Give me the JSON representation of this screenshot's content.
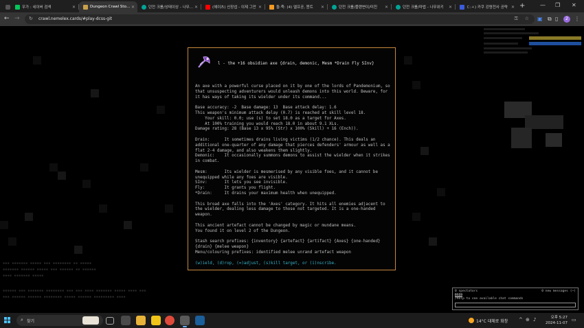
{
  "browser": {
    "tabs": [
      {
        "title": "우가 : 네이버 검색",
        "favicon_color": "#03c75a"
      },
      {
        "title": "Dungeon Crawl Stone Soup",
        "favicon_color": "#c9a04a",
        "active": true
      },
      {
        "title": "던전 크롤/상태이상 - 나무위키",
        "favicon_color": "#00a495"
      },
      {
        "title": "(헤이츠) 신장섭 - 이제 그만",
        "favicon_color": "#ff0000"
      },
      {
        "title": "돌·죽: (4) 엘프공, 몽트",
        "favicon_color": "#f59a23"
      },
      {
        "title": "던전 크롤/플랜변이/미친",
        "favicon_color": "#00a495"
      },
      {
        "title": "던전 크롤/마법 - 나무위키",
        "favicon_color": "#00a495"
      },
      {
        "title": "ㄷ:ㅅ) 카쿠 강령전사 공략",
        "favicon_color": "#3b5bdb"
      }
    ],
    "new_tab_label": "+",
    "url": "crawl.nemelex.cards/#play-dcss-git",
    "profile_initial": "2"
  },
  "popup": {
    "title": "l - the +16 obsidian axe {drain, demonic, Mesm *Drain Fly SInv}",
    "lines": [
      {
        "text": "An axe with a powerful curse placed on it by one of the lords of Pandemonium, so"
      },
      {
        "text": "that unsuspecting adventurers would unleash demons into this world. Beware, for"
      },
      {
        "text": "it has ways of taking its wielder under its command..."
      },
      {
        "text": "Base accuracy: -2  Base damage: 13  Base attack delay: 1.6",
        "gap": true
      },
      {
        "text": "This weapon's minimum attack delay (0.7) is reached at skill level 18."
      },
      {
        "text": "    Your skill: 0.0; use (s) to set 18.0 as a target for Axes."
      },
      {
        "text": "    At 100% training you would reach 18.0 in about 9.1 XLs."
      },
      {
        "text": "Damage rating: 28 (Base 13 x 95% (Str) x 100% (Skill) + 16 (Ench))."
      },
      {
        "text": "Drain:      It sometimes drains living victims (1/2 chance). This deals an",
        "gap": true
      },
      {
        "text": "additional one-quarter of any damage that pierces defenders' armour as well as a"
      },
      {
        "text": "flat 2-4 damage, and also weakens them slightly."
      },
      {
        "text": "Demonic:    It occasionally summons demons to assist the wielder when it strikes"
      },
      {
        "text": "in combat."
      },
      {
        "text": "Mesm:       Its wielder is mesmerised by any visible foes, and it cannot be",
        "gap": true
      },
      {
        "text": "unequipped while any foes are visible."
      },
      {
        "text": "SInv:       It lets you see invisible."
      },
      {
        "text": "Fly:        It grants you flight."
      },
      {
        "text": "*Drain:     It drains your maximum health when unequipped."
      },
      {
        "text": "This broad axe falls into the 'Axes' category. It hits all enemies adjacent to",
        "gap": true
      },
      {
        "text": "the wielder, dealing less damage to those not targeted. It is a one-handed"
      },
      {
        "text": "weapon."
      },
      {
        "text": "This ancient artefact cannot be changed by magic or mundane means.",
        "gap": true
      },
      {
        "text": "You found it on level 2 of the Dungeon."
      },
      {
        "text": "Stash search prefixes: {inventory} {artefact} {artifact} {Axes} {one-handed}",
        "gap": true
      },
      {
        "text": "{drain} {melee weapon}"
      },
      {
        "text": "Menu/colouring prefixes: identified melee unrand artefact weapon"
      }
    ],
    "commands": "(w)ield, (d)rop, (=)adjust, (s)kill target, or (i)nscribe."
  },
  "chat": {
    "spectators": "0 spectators",
    "new_messages": "0 new messages (~)",
    "user": "BSEB",
    "hint": "/help to see available chat commands"
  },
  "taskbar": {
    "search_label": "찾기",
    "weather": "14°C  대체로 화창",
    "time": "오후 5:27",
    "date": "2024-11-07"
  },
  "colors": {
    "popup_border": "#c98a3e",
    "command_text": "#37b4cc"
  }
}
